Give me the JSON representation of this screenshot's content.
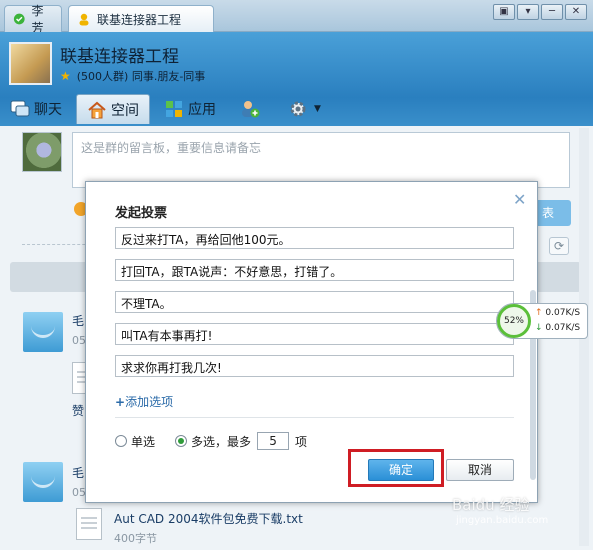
{
  "tabs": [
    {
      "label": "李芳"
    },
    {
      "label": "联基连接器工程"
    }
  ],
  "window_buttons": [
    "▣",
    "▾",
    "─",
    "✕"
  ],
  "group": {
    "name": "联基连接器工程",
    "subtitle": "(500人群) 同事.朋友-同事"
  },
  "nav": {
    "chat": "聊天",
    "space": "空间",
    "apps": "应用"
  },
  "board": {
    "placeholder": "这是群的留言板，重要信息请备忘",
    "publish": "表"
  },
  "feed": [
    {
      "name": "毛",
      "date": "05"
    },
    {
      "name": "毛",
      "date": "05"
    }
  ],
  "feed_like": "赞",
  "attachment": {
    "title": "Aut CAD 2004软件包免费下载.txt",
    "size": "400字节"
  },
  "dialog": {
    "title": "发起投票",
    "options": [
      "反过来打TA，再给回他100元。",
      "打回TA，跟TA说声：不好意思，打错了。",
      "不理TA。",
      "叫TA有本事再打!",
      "求求你再打我几次!"
    ],
    "add_option": "添加选项",
    "single": "单选",
    "multi": "多选，最多",
    "max_count": "5",
    "unit": "项",
    "ok": "确定",
    "cancel": "取消"
  },
  "net": {
    "percent": "52%",
    "up": "0.07K/S",
    "down": "0.07K/S"
  },
  "watermark": "Baidu 经验",
  "watermark_url": "jingyan.baidu.com"
}
